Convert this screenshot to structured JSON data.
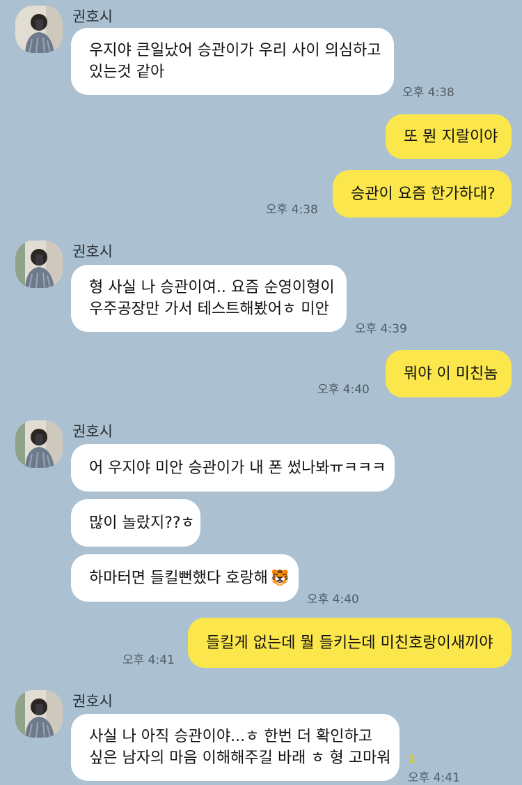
{
  "chat": {
    "sender_name": "권호시",
    "unread_count": "1",
    "messages": [
      {
        "dir": "in",
        "text_lines": [
          "우지야 큰일났어 승관이가 우리 사이 의심하고",
          "있는것 같아"
        ],
        "time": "오후 4:38"
      },
      {
        "dir": "out",
        "text_lines": [
          "또 뭔 지랄이야"
        ],
        "time": ""
      },
      {
        "dir": "out",
        "text_lines": [
          "승관이 요즘 한가하대?"
        ],
        "time": "오후 4:38"
      },
      {
        "dir": "in",
        "text_lines": [
          "형 사실 나 승관이여.. 요즘 순영이형이",
          "우주공장만 가서 테스트해봤어ㅎ 미안"
        ],
        "time": "오후 4:39"
      },
      {
        "dir": "out",
        "text_lines": [
          "뭐야 이 미친놈"
        ],
        "time": "오후 4:40"
      },
      {
        "dir": "in",
        "text_lines": [
          "어 우지야 미안 승관이가 내 폰 썼나봐ㅠㅋㅋㅋ"
        ],
        "time": ""
      },
      {
        "dir": "in",
        "text_lines": [
          "많이 놀랐지??ㅎ"
        ],
        "time": ""
      },
      {
        "dir": "in",
        "text_lines": [
          "하마터면 들킬뻔했다 호랑해"
        ],
        "emoji": "🐯",
        "time": "오후 4:40"
      },
      {
        "dir": "out",
        "text_lines": [
          "들킬게 없는데 뭘 들키는데 미친호랑이새끼야"
        ],
        "time": "오후 4:41"
      },
      {
        "dir": "in",
        "text_lines": [
          "사실 나 아직 승관이야...ㅎ 한번 더 확인하고",
          "싶은 남자의 마음 이해해주길 바래 ㅎ 형 고마워"
        ],
        "time": "오후 4:41"
      }
    ]
  }
}
